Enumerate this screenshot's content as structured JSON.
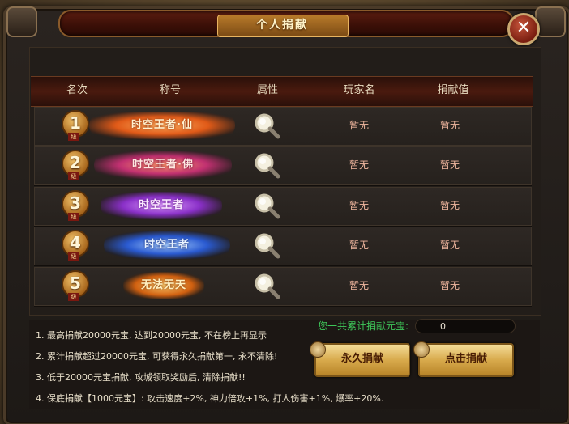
{
  "window": {
    "title": "个人捐献",
    "close_label": "✕"
  },
  "table": {
    "headers": [
      "名次",
      "称号",
      "属性",
      "玩家名",
      "捐献值"
    ],
    "rank_suffix": "级",
    "rows": [
      {
        "rank": "1",
        "title_text": "时空王者·仙",
        "player": "暂无",
        "value": "暂无"
      },
      {
        "rank": "2",
        "title_text": "时空王者·佛",
        "player": "暂无",
        "value": "暂无"
      },
      {
        "rank": "3",
        "title_text": "时空王者",
        "player": "暂无",
        "value": "暂无"
      },
      {
        "rank": "4",
        "title_text": "时空王者",
        "player": "暂无",
        "value": "暂无"
      },
      {
        "rank": "5",
        "title_text": "无法无天",
        "player": "暂无",
        "value": "暂无"
      }
    ]
  },
  "rules": [
    "1. 最高捐献20000元宝, 达到20000元宝, 不在榜上再显示",
    "2. 累计捐献超过20000元宝, 可获得永久捐献第一, 永不清除!",
    "3. 低于20000元宝捐献, 攻城领取奖励后, 清除捐献!!",
    "4. 保底捐献【1000元宝】: 攻击速度+2%, 神力倍攻+1%, 打人伤害+1%, 爆率+20%."
  ],
  "donation": {
    "total_label": "您一共累计捐献元宝:",
    "total_value": "0"
  },
  "buttons": {
    "permanent": "永久捐献",
    "click": "点击捐献"
  },
  "colors": {
    "accent_gold": "#d8aa4c",
    "status_green": "#3ec85a",
    "value_pink": "#f2b8a0"
  }
}
